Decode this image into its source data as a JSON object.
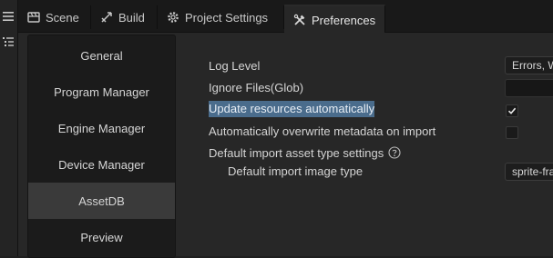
{
  "tabs": [
    {
      "label": "Scene",
      "icon": "scene-icon"
    },
    {
      "label": "Build",
      "icon": "build-icon"
    },
    {
      "label": "Project Settings",
      "icon": "gear-icon"
    },
    {
      "label": "Preferences",
      "icon": "tools-icon",
      "active": true
    }
  ],
  "sidebar": {
    "items": [
      {
        "label": "General"
      },
      {
        "label": "Program Manager"
      },
      {
        "label": "Engine Manager"
      },
      {
        "label": "Device Manager"
      },
      {
        "label": "AssetDB",
        "selected": true
      },
      {
        "label": "Preview"
      }
    ]
  },
  "settings": {
    "log_level": {
      "label": "Log Level",
      "value": "Errors, W"
    },
    "ignore_files": {
      "label": "Ignore Files(Glob)",
      "value": ""
    },
    "update_resources": {
      "label": "Update resources automatically",
      "checked": true
    },
    "overwrite_metadata": {
      "label": "Automatically overwrite metadata on import",
      "checked": false
    },
    "default_import_type": {
      "label": "Default import asset type settings"
    },
    "default_image_type": {
      "label": "Default import image type",
      "value": "sprite-fra"
    }
  },
  "colors": {
    "selection_highlight": "#4a6c8c",
    "sidebar_selected": "#3a3a3a"
  }
}
